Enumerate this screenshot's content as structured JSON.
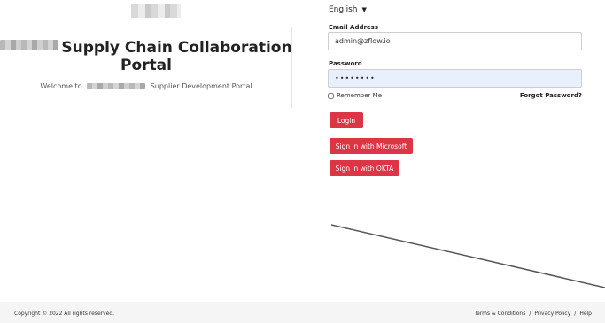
{
  "header": {
    "title_line1": "Supply Chain Collaboration",
    "title_line2": "Portal",
    "welcome_prefix": "Welcome to",
    "welcome_suffix": "Supplier Development Portal"
  },
  "language": {
    "selected": "English"
  },
  "form": {
    "email_label": "Email Address",
    "email_value": "admin@zflow.io",
    "password_label": "Password",
    "password_value": "••••••••",
    "remember_label": "Remember Me",
    "forgot_label": "Forgot Password?",
    "login_label": "Login",
    "microsoft_label": "Sign in with Microsoft",
    "okta_label": "Sign in with OKTA"
  },
  "footer": {
    "copyright": "Copyright © 2022 All rights reserved.",
    "terms": "Terms & Conditions",
    "privacy": "Privacy Policy",
    "help": "Help",
    "separator": "/"
  },
  "colors": {
    "primary_button": "#dc3545",
    "autofill_bg": "#e8f0fe",
    "footer_bg": "#f5f5f5"
  }
}
